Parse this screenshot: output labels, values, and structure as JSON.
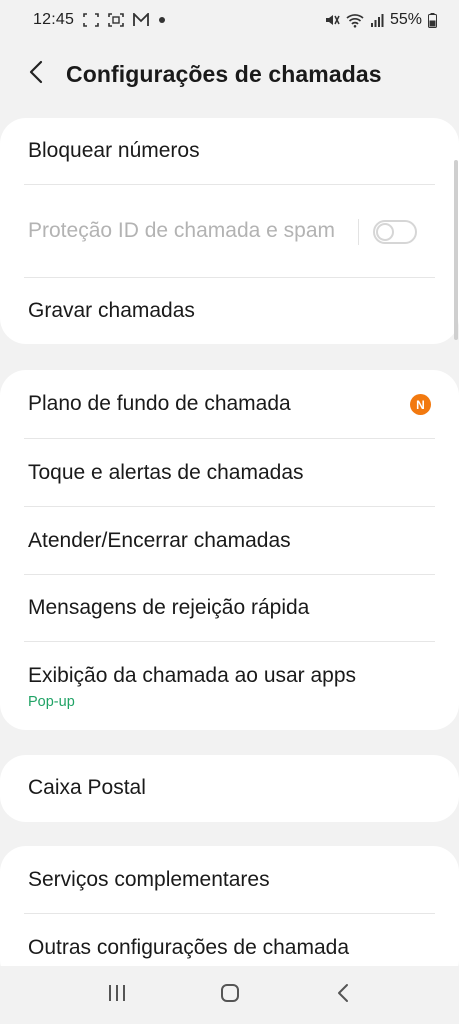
{
  "status_bar": {
    "time": "12:45",
    "battery": "55%",
    "left_icons": [
      "screenshot-icon",
      "scan-icon",
      "mail-icon",
      "dot-icon"
    ],
    "right_icons": [
      "mute-icon",
      "wifi-icon",
      "signal-icon",
      "battery-icon"
    ]
  },
  "header": {
    "title": "Configurações de chamadas",
    "back_icon": "back-arrow-icon"
  },
  "groups": [
    {
      "items": [
        {
          "label": "Bloquear números"
        },
        {
          "label": "Proteção ID de chamada e spam",
          "disabled": true,
          "toggle": false
        },
        {
          "label": "Gravar chamadas"
        }
      ]
    },
    {
      "items": [
        {
          "label": "Plano de fundo de chamada",
          "badge": "N"
        },
        {
          "label": "Toque e alertas de chamadas"
        },
        {
          "label": "Atender/Encerrar chamadas"
        },
        {
          "label": "Mensagens de rejeição rápida"
        },
        {
          "label": "Exibição da chamada ao usar apps",
          "sublabel": "Pop-up"
        }
      ]
    },
    {
      "items": [
        {
          "label": "Caixa Postal"
        }
      ]
    },
    {
      "items": [
        {
          "label": "Serviços complementares"
        },
        {
          "label": "Outras configurações de chamada"
        }
      ]
    }
  ],
  "colors": {
    "background": "#f2f2f2",
    "card": "#ffffff",
    "accent_green": "#21a366",
    "badge_orange": "#f2790f",
    "disabled_text": "#b3b3b3"
  },
  "nav_bar": {
    "icons": [
      "recent-apps-icon",
      "home-icon",
      "back-icon"
    ]
  }
}
